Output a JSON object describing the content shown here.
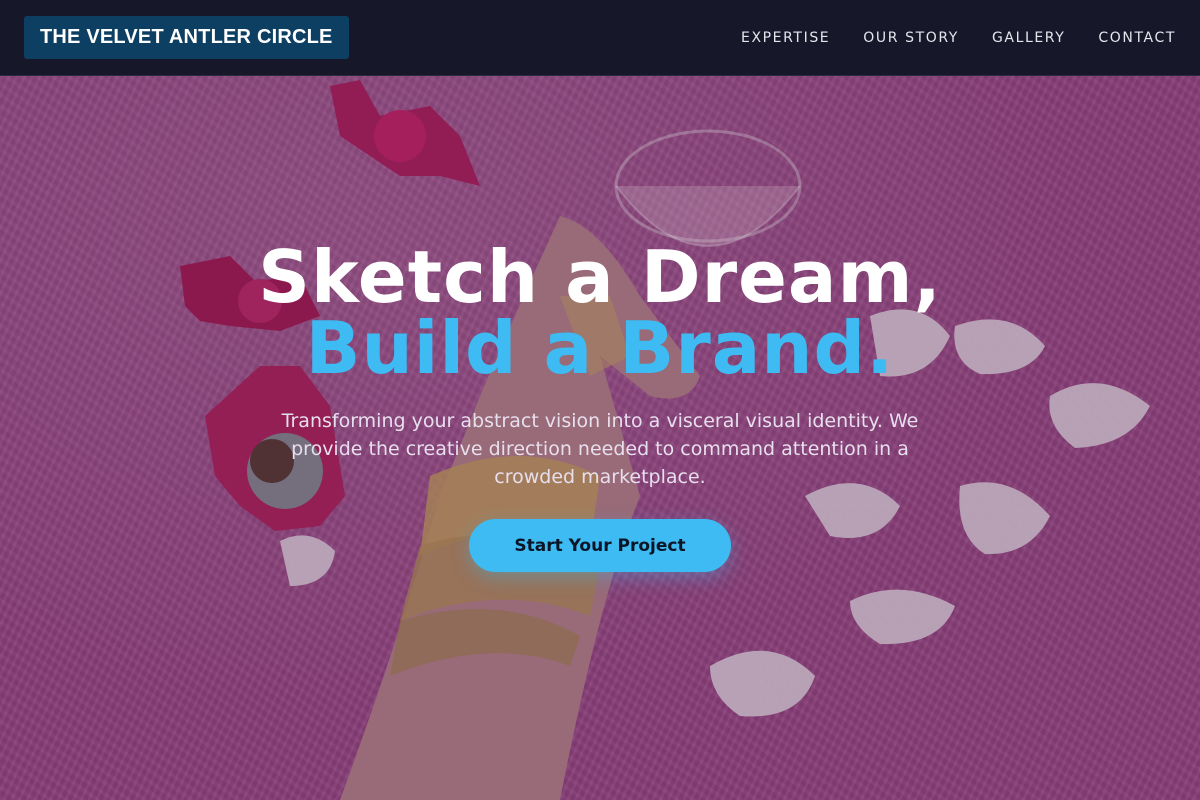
{
  "header": {
    "brand": "THE VELVET ANTLER CIRCLE",
    "nav": [
      "EXPERTISE",
      "OUR STORY",
      "GALLERY",
      "CONTACT"
    ]
  },
  "hero": {
    "headline_line1": "Sketch a Dream,",
    "headline_line2": "Build a Brand.",
    "subtext": "Transforming your abstract vision into a visceral visual identity. We provide the creative direction needed to command attention in a crowded marketplace.",
    "cta_label": "Start Your Project",
    "background_image": "hand with gold chain bracelets and rings on pink fur rug, candy wrappers, white petals, glass"
  },
  "colors": {
    "nav_bg": "#17172a",
    "brand_bg": "#0d3f63",
    "accent": "#3dbbf2",
    "hero_bg": "#a14a8a",
    "headline": "#ffffff"
  }
}
